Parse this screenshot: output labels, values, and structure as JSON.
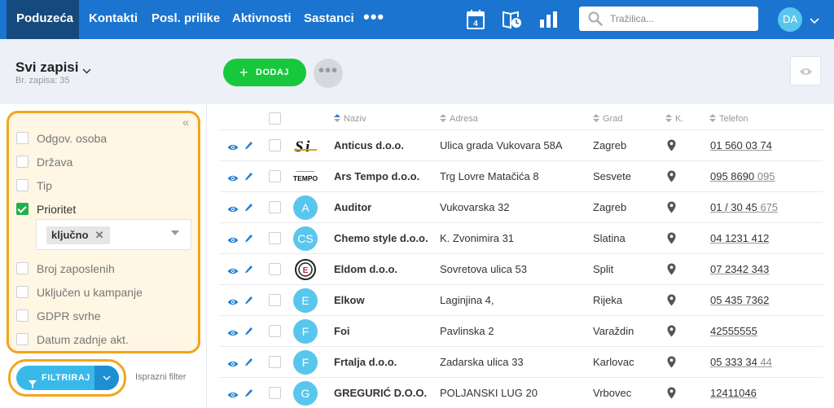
{
  "nav": {
    "items": [
      "Poduzeća",
      "Kontakti",
      "Posl. prilike",
      "Aktivnosti",
      "Sastanci"
    ],
    "more": "•••",
    "calendar_day": "4",
    "search_placeholder": "Tražilica...",
    "avatar": "DA"
  },
  "colors": {
    "nav_bg": "#1b74cf",
    "nav_active": "#164a7e",
    "add_button": "#17c83c",
    "highlight_outline": "#f3a51b",
    "filter_button": "#38b9ea",
    "avatar": "#59c6ee",
    "link_blue": "#1f7fd2"
  },
  "header": {
    "title": "Svi zapisi",
    "record_count": "Br. zapisa: 35",
    "add_label": "DODAJ",
    "more_label": "•••"
  },
  "filters": {
    "items": [
      {
        "label": "Odgov. osoba",
        "checked": false
      },
      {
        "label": "Država",
        "checked": false
      },
      {
        "label": "Tip",
        "checked": false
      },
      {
        "label": "Prioritet",
        "checked": true
      },
      {
        "label": "Broj zaposlenih",
        "checked": false
      },
      {
        "label": "Uključen u kampanje",
        "checked": false
      },
      {
        "label": "GDPR svrhe",
        "checked": false
      },
      {
        "label": "Datum zadnje akt.",
        "checked": false
      }
    ],
    "selected_tag": "ključno",
    "tag_remove": "✕",
    "apply_label": "FILTRIRAJ",
    "clear_label": "Isprazni filter",
    "collapse": "«"
  },
  "table": {
    "columns": [
      "Naziv",
      "Adresa",
      "Grad",
      "K.",
      "Telefon"
    ],
    "rows": [
      {
        "logo": "Si",
        "logo_type": "image-si",
        "name": "Anticus d.o.o.",
        "address": "Ulica grada Vukovara 58A",
        "city": "Zagreb",
        "phone": "01 560 03 74",
        "phone_ext": ""
      },
      {
        "logo": "TEMPO",
        "logo_type": "image-tempo",
        "name": "Ars Tempo d.o.o.",
        "address": "Trg Lovre Matačića 8",
        "city": "Sesvete",
        "phone": "095 8690 ",
        "phone_ext": "095"
      },
      {
        "logo": "A",
        "logo_type": "circle",
        "name": "Auditor",
        "address": "Vukovarska 32",
        "city": "Zagreb",
        "phone": "01 / 30 45 ",
        "phone_ext": "675"
      },
      {
        "logo": "CS",
        "logo_type": "circle",
        "name": "Chemo style d.o.o.",
        "address": "K. Zvonimira 31",
        "city": "Slatina",
        "phone": "04 1231 412",
        "phone_ext": ""
      },
      {
        "logo": "E",
        "logo_type": "image-eldom",
        "name": "Eldom d.o.o.",
        "address": "Sovretova ulica 53",
        "city": "Split",
        "phone": "07 2342 343",
        "phone_ext": ""
      },
      {
        "logo": "E",
        "logo_type": "circle",
        "name": "Elkow",
        "address": "Laginjina 4,",
        "city": "Rijeka",
        "phone": "05 435 7362",
        "phone_ext": ""
      },
      {
        "logo": "F",
        "logo_type": "circle",
        "name": "Foi",
        "address": "Pavlinska 2",
        "city": "Varaždin",
        "phone": "42555555",
        "phone_ext": ""
      },
      {
        "logo": "F",
        "logo_type": "circle",
        "name": "Frtalja d.o.o.",
        "address": "Zadarska ulica 33",
        "city": "Karlovac",
        "phone": "05 333 34 ",
        "phone_ext": "44"
      },
      {
        "logo": "G",
        "logo_type": "circle",
        "name": "GREGURIĆ D.O.O.",
        "address": "POLJANSKI LUG 20",
        "city": "Vrbovec",
        "phone": "12411046",
        "phone_ext": ""
      }
    ]
  }
}
